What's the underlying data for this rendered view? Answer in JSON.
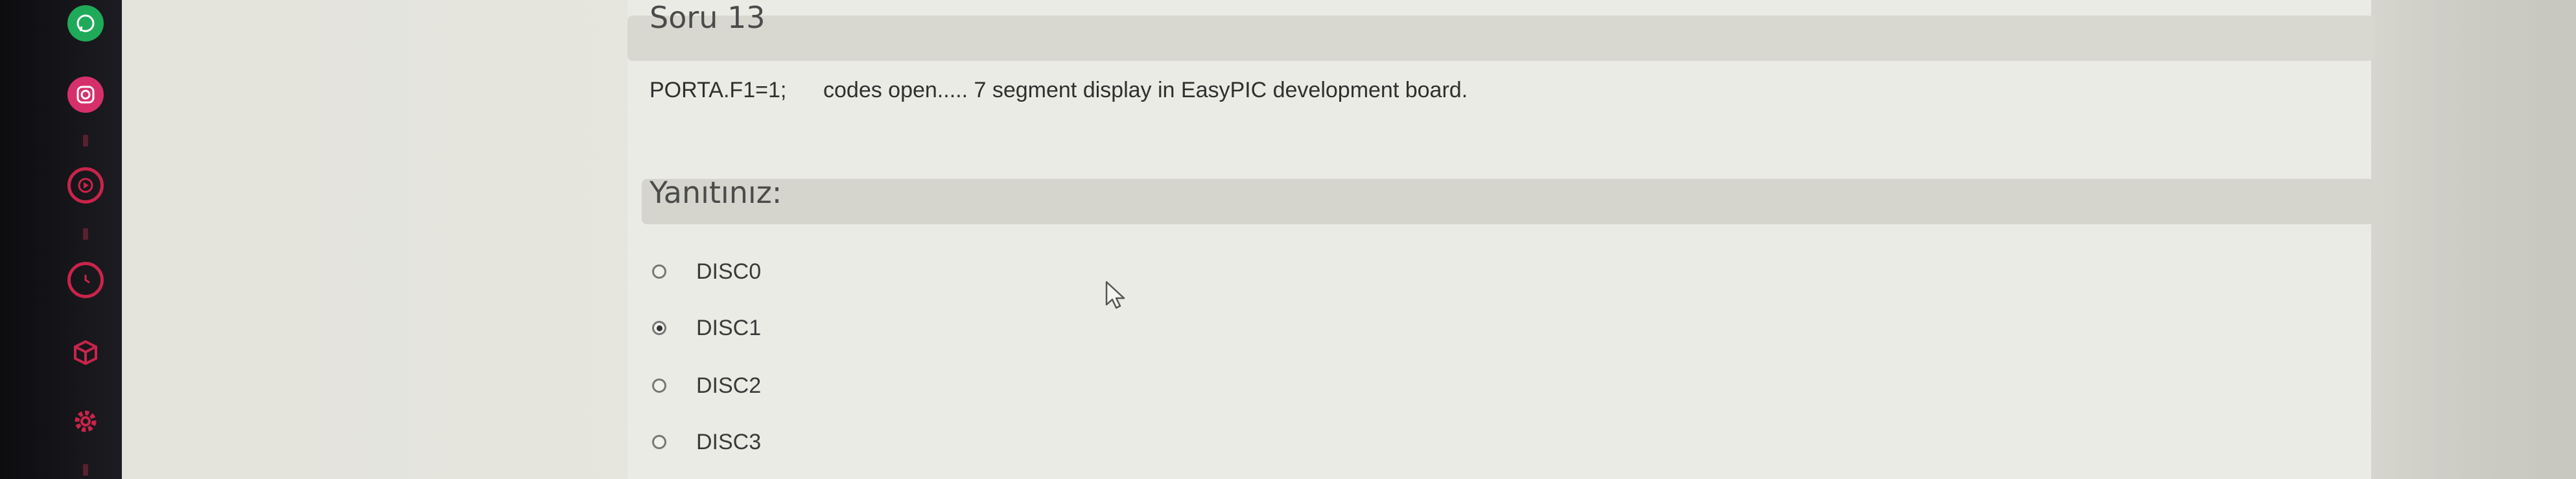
{
  "question": {
    "title": "Soru 13",
    "text": "PORTA.F1=1;      codes open..... 7 segment display in EasyPIC development board."
  },
  "answer": {
    "label": "Yanıtınız:",
    "options": [
      {
        "label": "DISC0",
        "selected": false
      },
      {
        "label": "DISC1",
        "selected": true
      },
      {
        "label": "DISC2",
        "selected": false
      },
      {
        "label": "DISC3",
        "selected": false
      }
    ]
  },
  "sidebar": {
    "icons": [
      "whatsapp-icon",
      "instagram-icon",
      "youtube-icon",
      "clock-icon",
      "cube-icon",
      "gear-icon"
    ]
  },
  "colors": {
    "whatsapp": "#1faa59",
    "instagram": "#d6306a",
    "accent_red": "#c9244a"
  }
}
